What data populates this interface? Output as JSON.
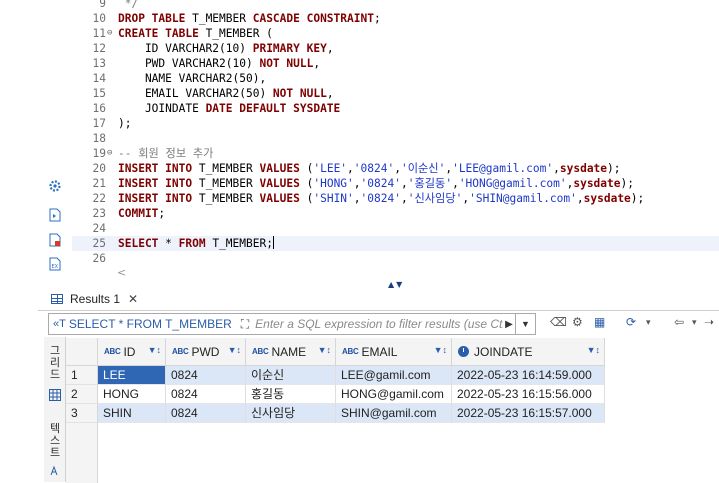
{
  "editor": {
    "lines": [
      {
        "num": "9",
        "fold": "",
        "segments": [
          {
            "t": "cm",
            "v": " */"
          }
        ]
      },
      {
        "num": "10",
        "fold": "",
        "segments": [
          {
            "t": "kw",
            "v": "DROP TABLE"
          },
          {
            "t": "id",
            "v": " T_MEMBER "
          },
          {
            "t": "kw",
            "v": "CASCADE CONSTRAINT"
          },
          {
            "t": "id",
            "v": ";"
          }
        ]
      },
      {
        "num": "11",
        "fold": "⊖",
        "segments": [
          {
            "t": "kw",
            "v": "CREATE TABLE"
          },
          {
            "t": "id",
            "v": " T_MEMBER ("
          }
        ]
      },
      {
        "num": "12",
        "fold": "",
        "segments": [
          {
            "t": "id",
            "v": "    ID VARCHAR2(10) "
          },
          {
            "t": "kw",
            "v": "PRIMARY KEY"
          },
          {
            "t": "id",
            "v": ","
          }
        ]
      },
      {
        "num": "13",
        "fold": "",
        "segments": [
          {
            "t": "id",
            "v": "    PWD VARCHAR2(10) "
          },
          {
            "t": "kw",
            "v": "NOT NULL"
          },
          {
            "t": "id",
            "v": ","
          }
        ]
      },
      {
        "num": "14",
        "fold": "",
        "segments": [
          {
            "t": "id",
            "v": "    NAME VARCHAR2(50),"
          }
        ]
      },
      {
        "num": "15",
        "fold": "",
        "segments": [
          {
            "t": "id",
            "v": "    EMAIL VARCHAR2(50) "
          },
          {
            "t": "kw",
            "v": "NOT NULL"
          },
          {
            "t": "id",
            "v": ","
          }
        ]
      },
      {
        "num": "16",
        "fold": "",
        "segments": [
          {
            "t": "id",
            "v": "    JOINDATE "
          },
          {
            "t": "kw",
            "v": "DATE DEFAULT SYSDATE"
          }
        ]
      },
      {
        "num": "17",
        "fold": "",
        "segments": [
          {
            "t": "id",
            "v": ");"
          }
        ]
      },
      {
        "num": "18",
        "fold": "",
        "segments": []
      },
      {
        "num": "19",
        "fold": "⊖",
        "segments": [
          {
            "t": "cm",
            "v": "-- 회원 정보 추가"
          }
        ]
      },
      {
        "num": "20",
        "fold": "",
        "segments": [
          {
            "t": "kw",
            "v": "INSERT INTO"
          },
          {
            "t": "id",
            "v": " T_MEMBER "
          },
          {
            "t": "kw",
            "v": "VALUES"
          },
          {
            "t": "id",
            "v": " ("
          },
          {
            "t": "str",
            "v": "'LEE'"
          },
          {
            "t": "id",
            "v": ","
          },
          {
            "t": "str",
            "v": "'0824'"
          },
          {
            "t": "id",
            "v": ","
          },
          {
            "t": "str",
            "v": "'이순신'"
          },
          {
            "t": "id",
            "v": ","
          },
          {
            "t": "str",
            "v": "'LEE@gamil.com'"
          },
          {
            "t": "id",
            "v": ","
          },
          {
            "t": "kw",
            "v": "sysdate"
          },
          {
            "t": "id",
            "v": ");"
          }
        ]
      },
      {
        "num": "21",
        "fold": "",
        "segments": [
          {
            "t": "kw",
            "v": "INSERT INTO"
          },
          {
            "t": "id",
            "v": " T_MEMBER "
          },
          {
            "t": "kw",
            "v": "VALUES"
          },
          {
            "t": "id",
            "v": " ("
          },
          {
            "t": "str",
            "v": "'HONG'"
          },
          {
            "t": "id",
            "v": ","
          },
          {
            "t": "str",
            "v": "'0824'"
          },
          {
            "t": "id",
            "v": ","
          },
          {
            "t": "str",
            "v": "'홍길동'"
          },
          {
            "t": "id",
            "v": ","
          },
          {
            "t": "str",
            "v": "'HONG@gamil.com'"
          },
          {
            "t": "id",
            "v": ","
          },
          {
            "t": "kw",
            "v": "sysdate"
          },
          {
            "t": "id",
            "v": ");"
          }
        ]
      },
      {
        "num": "22",
        "fold": "",
        "segments": [
          {
            "t": "kw",
            "v": "INSERT INTO"
          },
          {
            "t": "id",
            "v": " T_MEMBER "
          },
          {
            "t": "kw",
            "v": "VALUES"
          },
          {
            "t": "id",
            "v": " ("
          },
          {
            "t": "str",
            "v": "'SHIN'"
          },
          {
            "t": "id",
            "v": ","
          },
          {
            "t": "str",
            "v": "'0824'"
          },
          {
            "t": "id",
            "v": ","
          },
          {
            "t": "str",
            "v": "'신사임당'"
          },
          {
            "t": "id",
            "v": ","
          },
          {
            "t": "str",
            "v": "'SHIN@gamil.com'"
          },
          {
            "t": "id",
            "v": ","
          },
          {
            "t": "kw",
            "v": "sysdate"
          },
          {
            "t": "id",
            "v": ");"
          }
        ]
      },
      {
        "num": "23",
        "fold": "",
        "segments": [
          {
            "t": "kw",
            "v": "COMMIT"
          },
          {
            "t": "id",
            "v": ";"
          }
        ]
      },
      {
        "num": "24",
        "fold": "",
        "segments": []
      },
      {
        "num": "25",
        "fold": "",
        "current": true,
        "segments": [
          {
            "t": "kw",
            "v": "SELECT"
          },
          {
            "t": "id",
            "v": " * "
          },
          {
            "t": "kw",
            "v": "FROM"
          },
          {
            "t": "id",
            "v": " T_MEMBER;"
          }
        ]
      },
      {
        "num": "26",
        "fold": "",
        "segments": []
      }
    ]
  },
  "results": {
    "tab_label": "Results 1",
    "query_text": "SELECT * FROM T_MEMBER",
    "sql_icon_label": "«T",
    "filter_placeholder": "Enter a SQL expression to filter results (use Ctrl",
    "side_tabs": {
      "grid": "그리드",
      "text": "텍스트"
    },
    "columns": [
      {
        "type": "ABC",
        "name": "ID"
      },
      {
        "type": "ABC",
        "name": "PWD"
      },
      {
        "type": "ABC",
        "name": "NAME"
      },
      {
        "type": "ABC",
        "name": "EMAIL"
      },
      {
        "type": "clock",
        "name": "JOINDATE"
      }
    ],
    "rows": [
      {
        "num": "1",
        "cells": [
          "LEE",
          "0824",
          "이순신",
          "LEE@gamil.com",
          "2022-05-23 16:14:59.000"
        ]
      },
      {
        "num": "2",
        "cells": [
          "HONG",
          "0824",
          "홍길동",
          "HONG@gamil.com",
          "2022-05-23 16:15:56.000"
        ]
      },
      {
        "num": "3",
        "cells": [
          "SHIN",
          "0824",
          "신사임당",
          "SHIN@gamil.com",
          "2022-05-23 16:15:57.000"
        ]
      }
    ]
  }
}
